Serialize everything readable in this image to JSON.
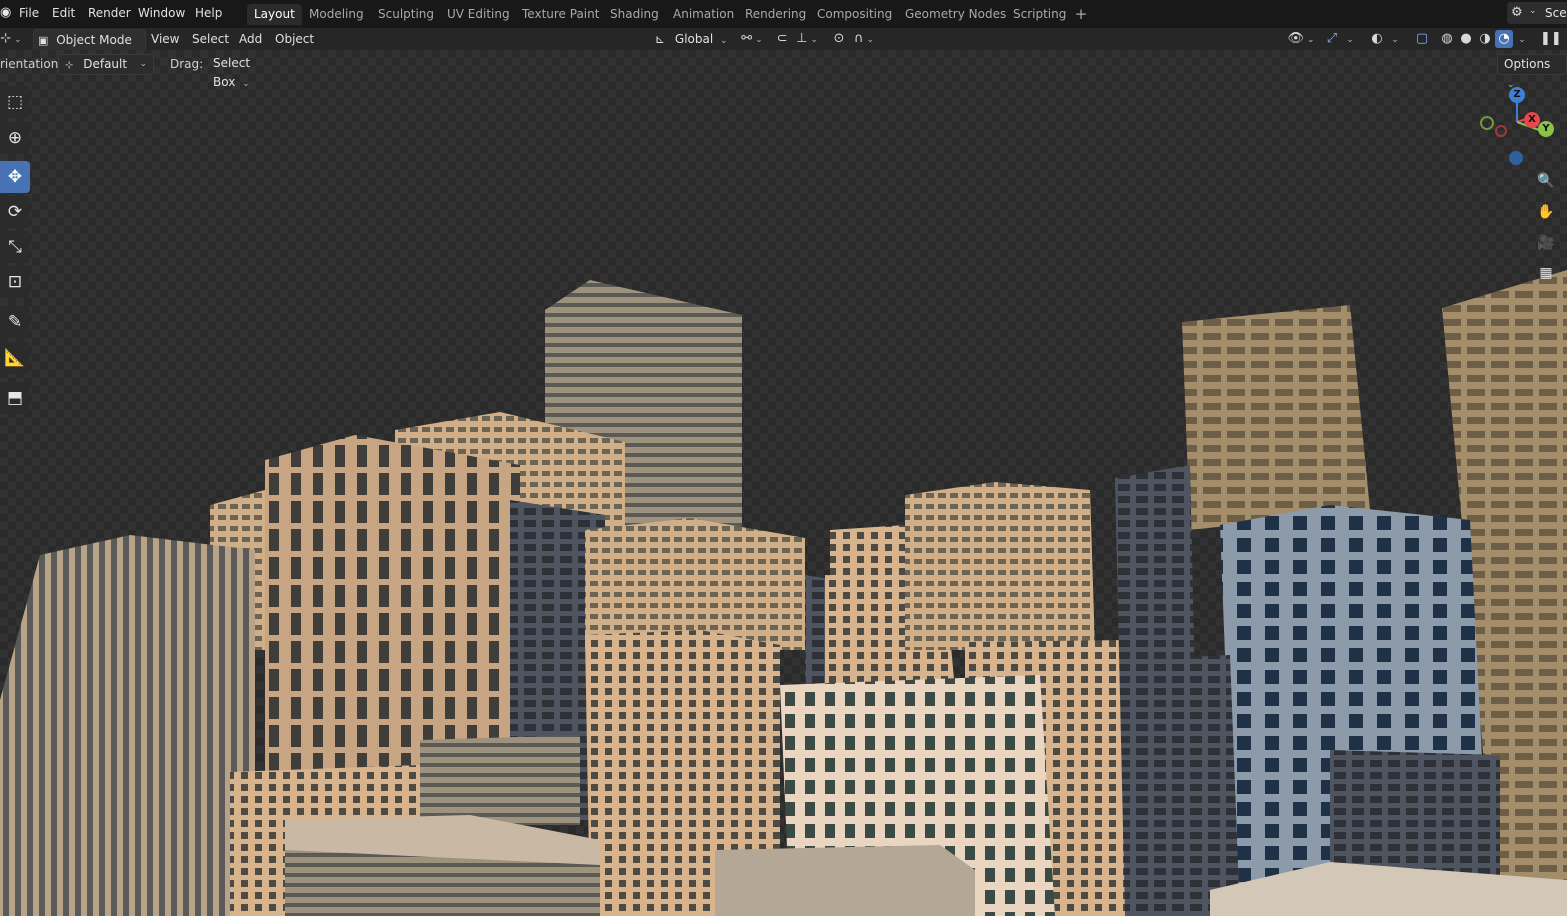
{
  "top_menu": [
    "File",
    "Edit",
    "Render",
    "Window",
    "Help"
  ],
  "workspaces": {
    "tabs": [
      "Layout",
      "Modeling",
      "Sculpting",
      "UV Editing",
      "Texture Paint",
      "Shading",
      "Animation",
      "Rendering",
      "Compositing",
      "Geometry Nodes",
      "Scripting"
    ],
    "active": "Layout",
    "add_label": "+"
  },
  "scene": {
    "label": "Sce"
  },
  "header": {
    "mode": "Object Mode",
    "menus": [
      "View",
      "Select",
      "Add",
      "Object"
    ],
    "transform_orientation": "Global"
  },
  "tool_settings": {
    "orientation_label": "rientation:",
    "orientation_value": "Default",
    "drag_label": "Drag:",
    "drag_value": "Select Box",
    "options_label": "Options"
  },
  "toolbar": {
    "tools": [
      "select-box",
      "cursor",
      "move",
      "rotate",
      "scale",
      "transform",
      "annotate",
      "measure",
      "add-cube"
    ],
    "active": "move"
  },
  "gizmo": {
    "axes": [
      "Z",
      "X",
      "Y"
    ],
    "colors": {
      "x": "#e5484d",
      "y": "#8bc34a",
      "z": "#3f7fd8"
    }
  },
  "nav_buttons": [
    "zoom-icon",
    "hand-pan-icon",
    "camera-icon",
    "grid-perspective-icon"
  ],
  "colors": {
    "accent": "#4772b3",
    "background": "#1d1d1d"
  }
}
